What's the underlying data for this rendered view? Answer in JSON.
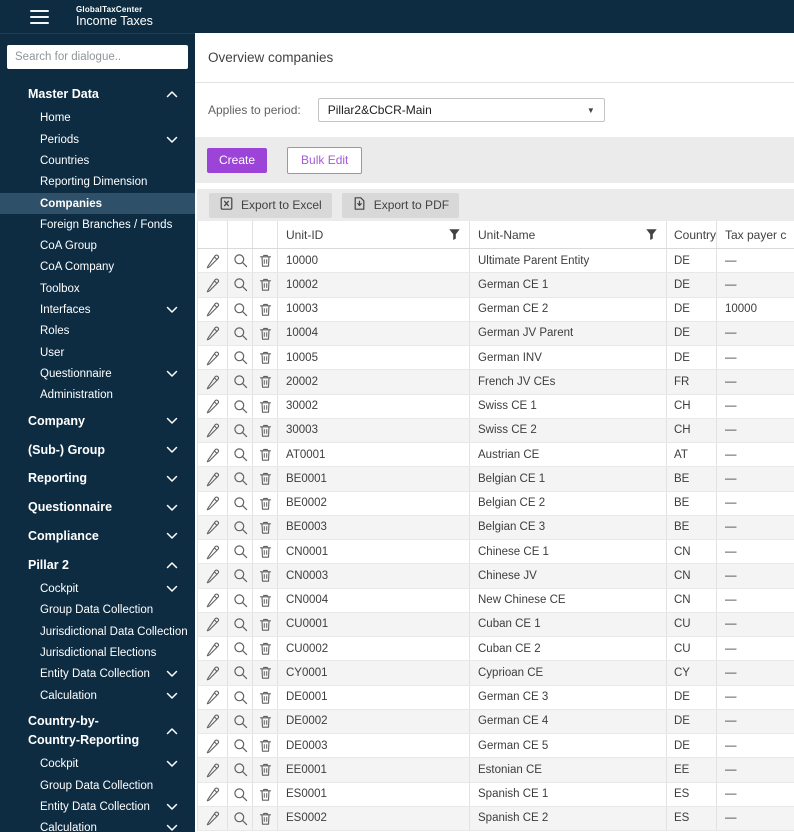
{
  "header": {
    "app_name": "GlobalTaxCenter",
    "app_subtitle": "Income Taxes"
  },
  "sidebar": {
    "search_placeholder": "Search for dialogue..",
    "items": [
      {
        "label": "Master Data",
        "type": "section",
        "chevron": "up"
      },
      {
        "label": "Home",
        "type": "sub"
      },
      {
        "label": "Periods",
        "type": "sub",
        "chevron": "down"
      },
      {
        "label": "Countries",
        "type": "sub"
      },
      {
        "label": "Reporting Dimension",
        "type": "sub"
      },
      {
        "label": "Companies",
        "type": "sub",
        "selected": true
      },
      {
        "label": "Foreign Branches / Fonds",
        "type": "sub"
      },
      {
        "label": "CoA Group",
        "type": "sub"
      },
      {
        "label": "CoA Company",
        "type": "sub"
      },
      {
        "label": "Toolbox",
        "type": "sub"
      },
      {
        "label": "Interfaces",
        "type": "sub",
        "chevron": "down"
      },
      {
        "label": "Roles",
        "type": "sub"
      },
      {
        "label": "User",
        "type": "sub"
      },
      {
        "label": "Questionnaire",
        "type": "sub",
        "chevron": "down"
      },
      {
        "label": "Administration",
        "type": "sub"
      },
      {
        "label": "Company",
        "type": "section",
        "chevron": "down"
      },
      {
        "label": "(Sub-) Group",
        "type": "section",
        "chevron": "down"
      },
      {
        "label": "Reporting",
        "type": "section",
        "chevron": "down"
      },
      {
        "label": "Questionnaire",
        "type": "section",
        "chevron": "down"
      },
      {
        "label": "Compliance",
        "type": "section",
        "chevron": "down"
      },
      {
        "label": "Pillar 2",
        "type": "section",
        "chevron": "up"
      },
      {
        "label": "Cockpit",
        "type": "sub",
        "chevron": "down"
      },
      {
        "label": "Group Data Collection",
        "type": "sub"
      },
      {
        "label": "Jurisdictional Data Collection",
        "type": "sub"
      },
      {
        "label": "Jurisdictional Elections",
        "type": "sub"
      },
      {
        "label": "Entity Data Collection",
        "type": "sub",
        "chevron": "down"
      },
      {
        "label": "Calculation",
        "type": "sub",
        "chevron": "down"
      },
      {
        "label": "Country-by-Country-Reporting",
        "type": "section",
        "chevron": "up"
      },
      {
        "label": "Cockpit",
        "type": "sub",
        "chevron": "down"
      },
      {
        "label": "Group Data Collection",
        "type": "sub"
      },
      {
        "label": "Entity Data Collection",
        "type": "sub",
        "chevron": "down"
      },
      {
        "label": "Calculation",
        "type": "sub",
        "chevron": "down"
      }
    ]
  },
  "main": {
    "page_title": "Overview companies",
    "period": {
      "label": "Applies to period:",
      "value": "Pillar2&CbCR-Main"
    },
    "actions": {
      "create_label": "Create",
      "bulk_edit_label": "Bulk Edit"
    },
    "export": {
      "excel_label": "Export to Excel",
      "pdf_label": "Export to PDF"
    },
    "table": {
      "columns": [
        "Unit-ID",
        "Unit-Name",
        "Country",
        "Tax payer c"
      ],
      "row_action_icons": [
        "edit-pencil-icon",
        "view-magnifier-icon",
        "delete-trash-icon"
      ],
      "rows": [
        {
          "unit_id": "10000",
          "unit_name": "Ultimate Parent Entity",
          "country": "DE",
          "tax_payer": "—"
        },
        {
          "unit_id": "10002",
          "unit_name": "German CE 1",
          "country": "DE",
          "tax_payer": "—"
        },
        {
          "unit_id": "10003",
          "unit_name": "German CE 2",
          "country": "DE",
          "tax_payer": "10000"
        },
        {
          "unit_id": "10004",
          "unit_name": "German JV Parent",
          "country": "DE",
          "tax_payer": "—"
        },
        {
          "unit_id": "10005",
          "unit_name": "German INV",
          "country": "DE",
          "tax_payer": "—"
        },
        {
          "unit_id": "20002",
          "unit_name": "French JV CEs",
          "country": "FR",
          "tax_payer": "—"
        },
        {
          "unit_id": "30002",
          "unit_name": "Swiss CE 1",
          "country": "CH",
          "tax_payer": "—"
        },
        {
          "unit_id": "30003",
          "unit_name": "Swiss CE 2",
          "country": "CH",
          "tax_payer": "—"
        },
        {
          "unit_id": "AT0001",
          "unit_name": "Austrian CE",
          "country": "AT",
          "tax_payer": "—"
        },
        {
          "unit_id": "BE0001",
          "unit_name": "Belgian CE 1",
          "country": "BE",
          "tax_payer": "—"
        },
        {
          "unit_id": "BE0002",
          "unit_name": "Belgian CE 2",
          "country": "BE",
          "tax_payer": "—"
        },
        {
          "unit_id": "BE0003",
          "unit_name": "Belgian CE 3",
          "country": "BE",
          "tax_payer": "—"
        },
        {
          "unit_id": "CN0001",
          "unit_name": "Chinese CE 1",
          "country": "CN",
          "tax_payer": "—"
        },
        {
          "unit_id": "CN0003",
          "unit_name": "Chinese JV",
          "country": "CN",
          "tax_payer": "—"
        },
        {
          "unit_id": "CN0004",
          "unit_name": "New Chinese CE",
          "country": "CN",
          "tax_payer": "—"
        },
        {
          "unit_id": "CU0001",
          "unit_name": "Cuban CE 1",
          "country": "CU",
          "tax_payer": "—"
        },
        {
          "unit_id": "CU0002",
          "unit_name": "Cuban CE 2",
          "country": "CU",
          "tax_payer": "—"
        },
        {
          "unit_id": "CY0001",
          "unit_name": "Cyprioan CE",
          "country": "CY",
          "tax_payer": "—"
        },
        {
          "unit_id": "DE0001",
          "unit_name": "German CE 3",
          "country": "DE",
          "tax_payer": "—"
        },
        {
          "unit_id": "DE0002",
          "unit_name": "German CE 4",
          "country": "DE",
          "tax_payer": "—"
        },
        {
          "unit_id": "DE0003",
          "unit_name": "German CE 5",
          "country": "DE",
          "tax_payer": "—"
        },
        {
          "unit_id": "EE0001",
          "unit_name": "Estonian CE",
          "country": "EE",
          "tax_payer": "—"
        },
        {
          "unit_id": "ES0001",
          "unit_name": "Spanish CE 1",
          "country": "ES",
          "tax_payer": "—"
        },
        {
          "unit_id": "ES0002",
          "unit_name": "Spanish CE 2",
          "country": "ES",
          "tax_payer": "—"
        }
      ]
    }
  },
  "colors": {
    "header_navy": "#0d2c42",
    "selected_item_bg": "#2e5068",
    "accent_purple": "#9c44d8",
    "toolbar_gray": "#ebebeb",
    "zebra_gray": "#f4f4f4"
  }
}
